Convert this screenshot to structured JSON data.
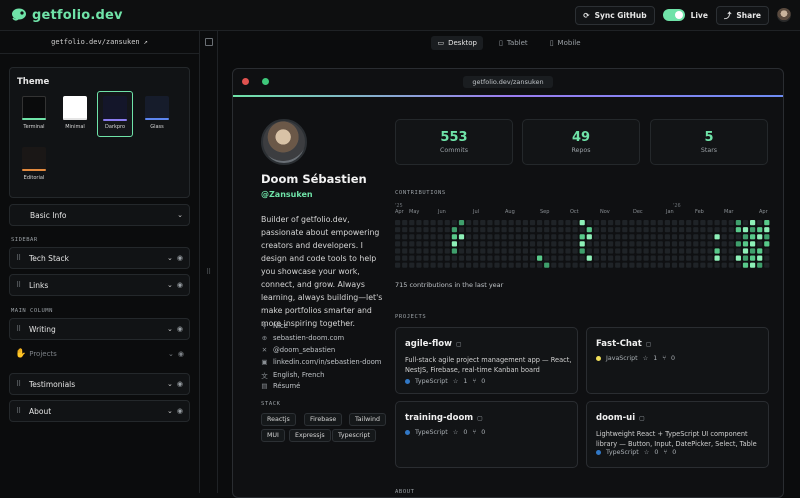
{
  "app": {
    "brand": "getfolio.dev"
  },
  "top": {
    "sync_label": "Sync GitHub",
    "live_label": "Live",
    "share_label": "Share"
  },
  "left": {
    "url": "getfolio.dev/zansuken",
    "theme_title": "Theme",
    "themes": [
      {
        "label": "Terminal",
        "chip": "#0a0b0c",
        "bar": "#6fe3a8"
      },
      {
        "label": "Minimal",
        "chip": "#ffffff",
        "bar": "#e5e5e5"
      },
      {
        "label": "Darkpro",
        "chip": "#14162a",
        "bar": "#8b7cf0"
      },
      {
        "label": "Glass",
        "chip": "#161c2b",
        "bar": "#5d86f0"
      },
      {
        "label": "Editorial",
        "chip": "#1a1716",
        "bar": "#e38a3e"
      }
    ],
    "basic_info": "Basic Info",
    "sidebar_label": "SIDEBAR",
    "sidebar_items": [
      "Tech Stack",
      "Links"
    ],
    "main_label": "MAIN COLUMN",
    "main_items": [
      "Writing",
      "Projects",
      "Testimonials",
      "About"
    ]
  },
  "devices": {
    "desktop": "Desktop",
    "tablet": "Tablet",
    "mobile": "Mobile"
  },
  "preview": {
    "url": "getfolio.dev/zansuken",
    "name": "Doom Sébastien",
    "handle": "@Zansuken",
    "bio": "Builder of getfolio.dev, passionate about empowering creators and developers. I design and code tools to help you showcase your work, connect, and grow. Always learning, always building—let's make portfolios smarter and more inspiring together.",
    "meta": {
      "location": "Nice",
      "website": "sebastien-doom.com",
      "x": "@doom_sebastien",
      "linkedin": "linkedin.com/in/sebastien-doom",
      "languages": "English, French",
      "resume": "Résumé"
    },
    "stack_label": "STACK",
    "stack": [
      "Reactjs",
      "Firebase",
      "Tailwind",
      "MUI",
      "Expressjs",
      "Typescript"
    ],
    "stats": [
      {
        "value": "553",
        "label": "Commits"
      },
      {
        "value": "49",
        "label": "Repos"
      },
      {
        "value": "5",
        "label": "Stars"
      }
    ],
    "contributions_label": "CONTRIBUTIONS",
    "months": [
      "Apr",
      "May",
      "Jun",
      "Jul",
      "Aug",
      "Sep",
      "Oct",
      "Nov",
      "Dec",
      "Jan",
      "Feb",
      "Mar",
      "Apr"
    ],
    "year_marks": [
      "'25",
      "'26"
    ],
    "contributions_note": "715 contributions in the last year",
    "projects_label": "PROJECTS",
    "projects": [
      {
        "title": "agile-flow",
        "desc": "Full-stack agile project management app — React, NestJS, Firebase, real-time Kanban board",
        "lang": "TypeScript",
        "lang_color": "#3178c6",
        "stars": "1",
        "forks": "0"
      },
      {
        "title": "Fast-Chat",
        "desc": "",
        "lang": "JavaScript",
        "lang_color": "#f1e05a",
        "stars": "1",
        "forks": "0"
      },
      {
        "title": "training-doom",
        "desc": "",
        "lang": "TypeScript",
        "lang_color": "#3178c6",
        "stars": "0",
        "forks": "0"
      },
      {
        "title": "doom-ui",
        "desc": "Lightweight React + TypeScript UI component library — Button, Input, DatePicker, Select, Table",
        "lang": "TypeScript",
        "lang_color": "#3178c6",
        "stars": "0",
        "forks": "0"
      }
    ],
    "about_label": "ABOUT"
  }
}
